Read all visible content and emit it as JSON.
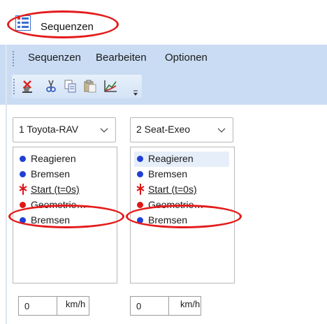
{
  "window": {
    "title": "Sequenzen",
    "app_icon": "list-sequence-icon"
  },
  "menu": {
    "items": [
      "Sequenzen",
      "Bearbeiten",
      "Optionen"
    ]
  },
  "toolbar": {
    "icons": [
      "clear-icon",
      "cut-icon",
      "copy-icon",
      "paste-icon",
      "chart-icon",
      "overflow-chevron-icon"
    ]
  },
  "panels": [
    {
      "dropdown": "1 Toyota-RAV",
      "items": [
        {
          "label": "Reagieren",
          "marker": "blue-dot"
        },
        {
          "label": "Bremsen",
          "marker": "blue-dot"
        },
        {
          "label": "Start (t=0s)",
          "marker": "red-start-icon"
        },
        {
          "label": "Geometrie…",
          "marker": "red-dot"
        },
        {
          "label": "Bremsen",
          "marker": "blue-dot"
        }
      ],
      "speed_value": "0",
      "speed_unit": "km/h"
    },
    {
      "dropdown": "2 Seat-Exeo",
      "items": [
        {
          "label": "Reagieren",
          "marker": "blue-dot",
          "selected": true
        },
        {
          "label": "Bremsen",
          "marker": "blue-dot"
        },
        {
          "label": "Start (t=0s)",
          "marker": "red-start-icon"
        },
        {
          "label": "Geometrie…",
          "marker": "red-dot"
        },
        {
          "label": "Bremsen",
          "marker": "blue-dot"
        }
      ],
      "speed_value": "0",
      "speed_unit": "km/h"
    }
  ],
  "colors": {
    "blue_dot": "#1f3fd6",
    "red_dot": "#e01515",
    "annotation": "#e41b1b",
    "chrome": "#c9dcf3"
  }
}
